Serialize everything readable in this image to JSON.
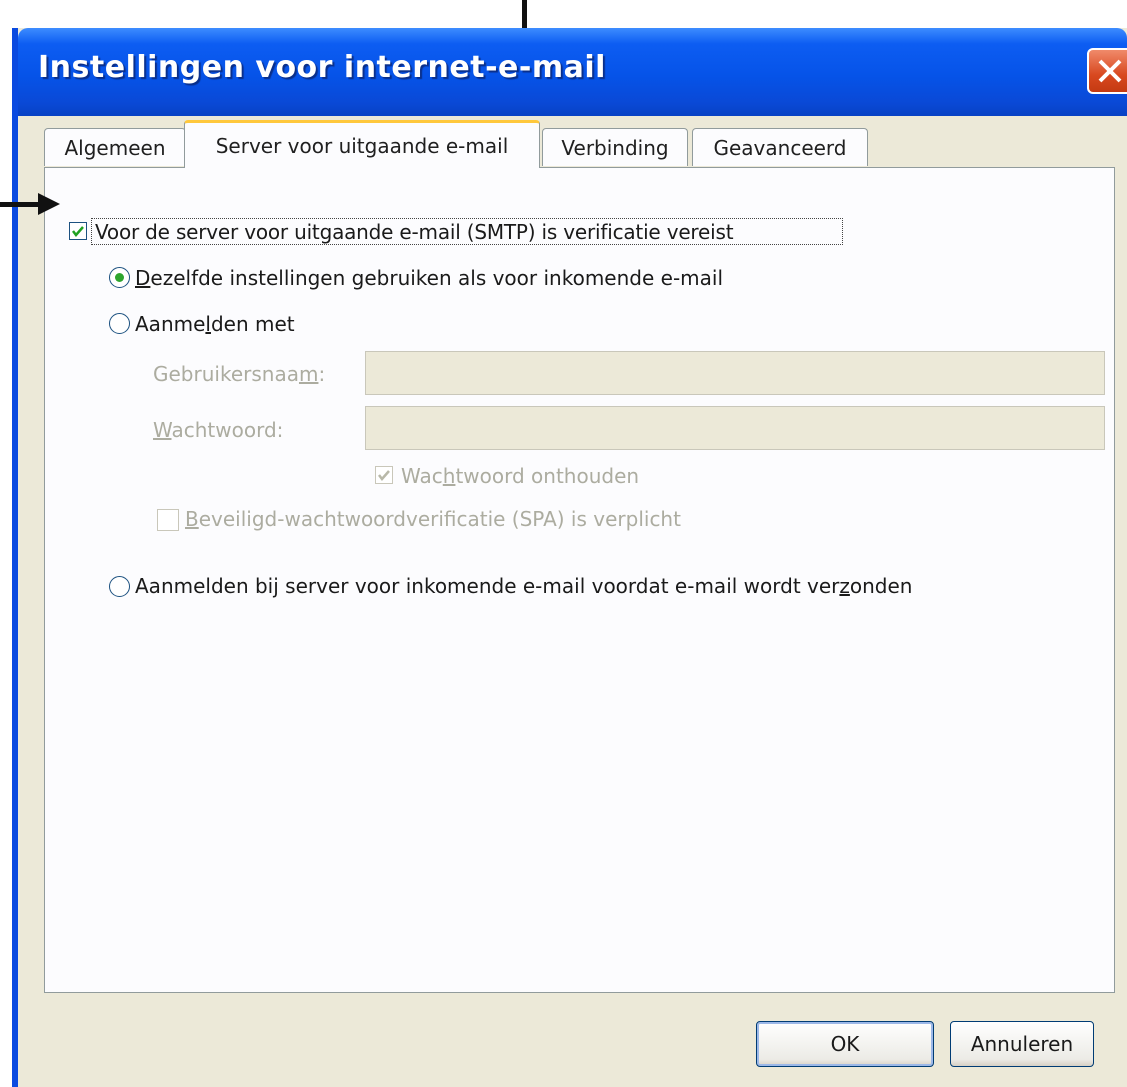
{
  "window": {
    "title": "Instellingen voor internet-e-mail"
  },
  "tabs": [
    {
      "label": "Algemeen"
    },
    {
      "label": "Server voor uitgaande e-mail"
    },
    {
      "label": "Verbinding"
    },
    {
      "label": "Geavanceerd"
    }
  ],
  "smtp_auth": {
    "label": "Voor de server voor uitgaande e-mail (SMTP) is verificatie vereist",
    "checked": true
  },
  "options": {
    "same_settings": {
      "label_pre": "",
      "label_u": "D",
      "label_post": "ezelfde instellingen gebruiken als voor inkomende e-mail",
      "selected": true
    },
    "login_with": {
      "label_pre": "Aanme",
      "label_u": "l",
      "label_post": "den met",
      "selected": false
    },
    "login_incoming_first": {
      "label_pre": "Aanmelden bij server voor inkomende e-mail voordat e-mail wordt ver",
      "label_u": "z",
      "label_post": "onden",
      "selected": false
    }
  },
  "fields": {
    "username": {
      "label_pre": "Gebruikersnaa",
      "label_u": "m",
      "label_post": ":",
      "value": ""
    },
    "password": {
      "label_pre": "",
      "label_u": "W",
      "label_post": "achtwoord:",
      "value": ""
    }
  },
  "remember_password": {
    "label_pre": "Wac",
    "label_u": "h",
    "label_post": "twoord onthouden",
    "checked": true
  },
  "spa": {
    "label_pre": "",
    "label_u": "B",
    "label_post": "eveiligd-wachtwoordverificatie (SPA) is verplicht",
    "checked": false
  },
  "buttons": {
    "ok": "OK",
    "cancel": "Annuleren"
  },
  "icons": {
    "close": "close-icon",
    "check": "checkmark-icon",
    "arrow_down": "arrow-down-icon",
    "arrow_right": "arrow-right-icon"
  },
  "colors": {
    "titlebar": "#0653e8",
    "window_bg": "#ece9d8",
    "active_tab_accent": "#ffc83c",
    "check_green": "#2ea52e"
  }
}
